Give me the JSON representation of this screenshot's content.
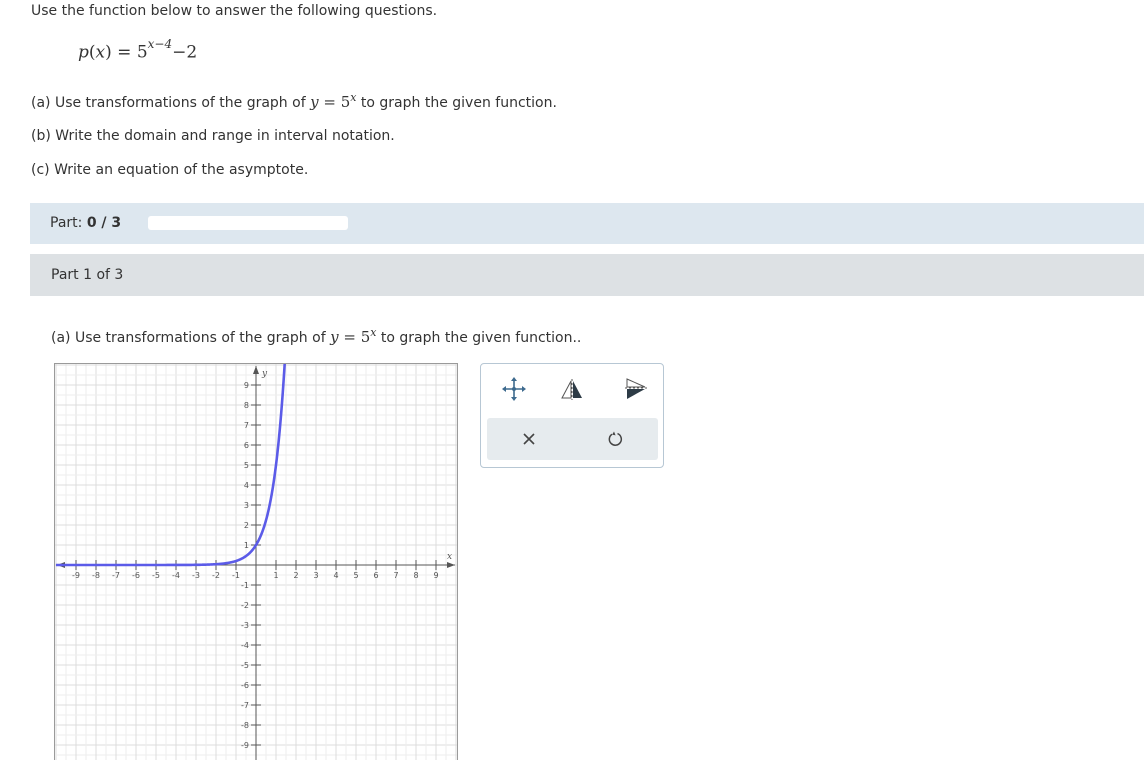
{
  "instructions": "Use the function below to answer the following questions.",
  "function": {
    "name": "p",
    "var": "x",
    "base": "5",
    "exponent": "x−4",
    "shift": "−2"
  },
  "questions": {
    "a_prefix": "(a) Use transformations of the graph of",
    "a_suffix": "to graph the given function.",
    "b": "(b) Write the domain and range in interval notation.",
    "c": "(c) Write an equation of the asymptote."
  },
  "parent": {
    "lhs": "y",
    "base": "5",
    "exponent": "x"
  },
  "progress": {
    "label": "Part:",
    "value": "0 / 3",
    "fraction": 0
  },
  "part1": {
    "title": "Part 1 of 3",
    "prompt_prefix": "(a) Use transformations of the graph of",
    "prompt_suffix": "to graph the given function.."
  },
  "graph": {
    "x_axis_label": "x",
    "y_axis_label": "y",
    "x_range": [
      -10,
      10
    ],
    "y_range": [
      -10,
      10
    ],
    "x_ticks": [
      "-9",
      "-8",
      "-7",
      "-6",
      "-5",
      "-4",
      "-3",
      "-2",
      "-1",
      "1",
      "2",
      "3",
      "4",
      "5",
      "6",
      "7",
      "8",
      "9"
    ],
    "y_ticks": [
      "9",
      "8",
      "7",
      "6",
      "5",
      "4",
      "3",
      "2",
      "1",
      "-1",
      "-2",
      "-3",
      "-4",
      "-5",
      "-6",
      "-7",
      "-8",
      "-9"
    ],
    "curve_color": "#5b5be8",
    "curve_function": "5^x"
  },
  "tools": {
    "move": "move-icon",
    "reflect_vertical": "reflect-vertical-icon",
    "reflect_horizontal": "reflect-horizontal-icon",
    "delete": "delete-icon",
    "reset": "reset-icon"
  }
}
